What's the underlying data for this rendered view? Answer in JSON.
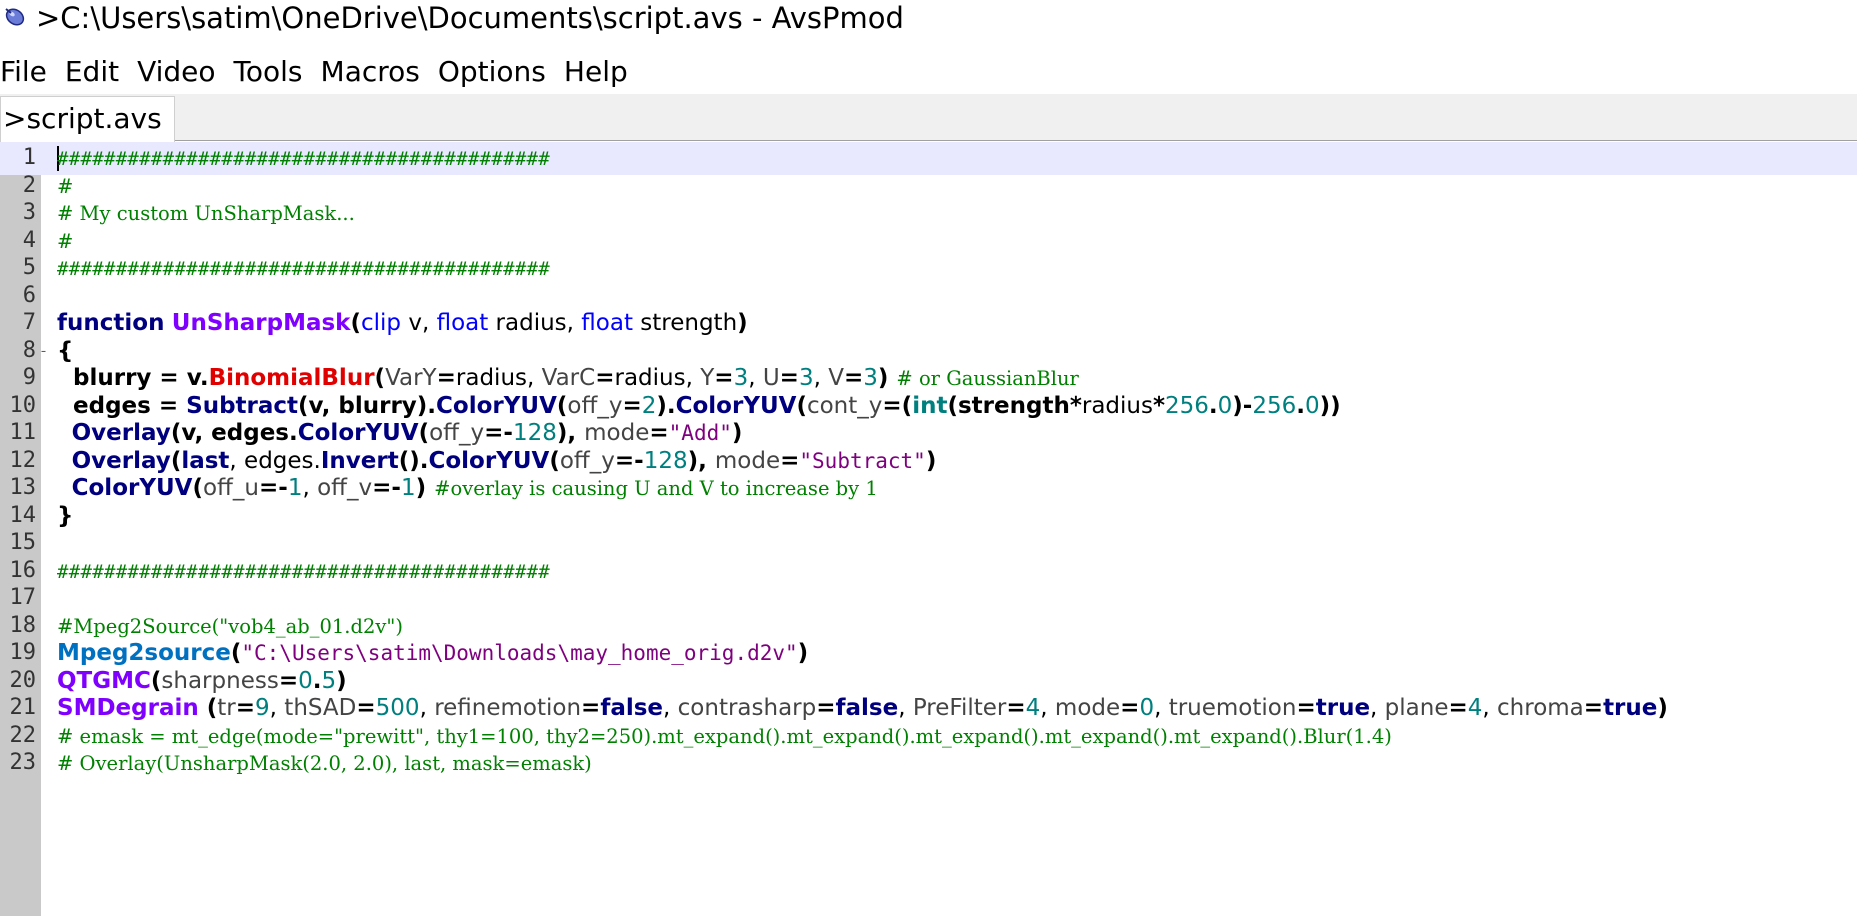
{
  "window": {
    "title": ">C:\\Users\\satim\\OneDrive\\Documents\\script.avs - AvsPmod",
    "icon": "avspmod-app-icon"
  },
  "menu": {
    "items": [
      "File",
      "Edit",
      "Video",
      "Tools",
      "Macros",
      "Options",
      "Help"
    ]
  },
  "tabs": [
    {
      "label": ">script.avs",
      "active": true
    }
  ],
  "editor": {
    "current_line": 1,
    "lines": [
      {
        "n": "1"
      },
      {
        "n": "2"
      },
      {
        "n": "3"
      },
      {
        "n": "4"
      },
      {
        "n": "5"
      },
      {
        "n": "6"
      },
      {
        "n": "7"
      },
      {
        "n": "8"
      },
      {
        "n": "9"
      },
      {
        "n": "10"
      },
      {
        "n": "11"
      },
      {
        "n": "12"
      },
      {
        "n": "13"
      },
      {
        "n": "14"
      },
      {
        "n": "15"
      },
      {
        "n": "16"
      },
      {
        "n": "17"
      },
      {
        "n": "18"
      },
      {
        "n": "19"
      },
      {
        "n": "20"
      },
      {
        "n": "21"
      },
      {
        "n": "22"
      },
      {
        "n": "23"
      }
    ],
    "text": {
      "hashline": "##########################################",
      "hash": "#",
      "l3": "# My custom UnSharpMask...",
      "l7_function": "function",
      "l7_name": "UnSharpMask",
      "l7_open": "(",
      "l7_clip": "clip",
      "l7_v": " v, ",
      "l7_float": "float",
      "l7_radius": " radius, ",
      "l7_float2": "float",
      "l7_strength": " strength",
      "l7_close": ")",
      "l8": "{",
      "l9_a": "  blurry = v.",
      "l9_fn": "BinomialBlur",
      "l9_b": "(",
      "l9_p1": "VarY",
      "l9_e1": "=",
      "l9_v1": "radius, ",
      "l9_p2": "VarC",
      "l9_e2": "=",
      "l9_v2": "radius, ",
      "l9_p3": "Y",
      "l9_e3": "=",
      "l9_n3": "3",
      "l9_c3": ", ",
      "l9_p4": "U",
      "l9_e4": "=",
      "l9_n4": "3",
      "l9_c4": ", ",
      "l9_p5": "V",
      "l9_e5": "=",
      "l9_n5": "3",
      "l9_close": ") ",
      "l9_cm": "# or GaussianBlur",
      "l10_a": "  edges = ",
      "l10_fn1": "Subtract",
      "l10_b": "(v, blurry).",
      "l10_fn2": "ColorYUV",
      "l10_c": "(",
      "l10_p1": "off_y",
      "l10_e1": "=",
      "l10_n1": "2",
      "l10_d": ").",
      "l10_fn3": "ColorYUV",
      "l10_e": "(",
      "l10_p2": "cont_y",
      "l10_e2": "=(",
      "l10_int": "int",
      "l10_f": "(strength",
      "l10_g": "*",
      "l10_h": "radius",
      "l10_i": "*",
      "l10_n2": "256",
      "l10_dot1": ".",
      "l10_n3": "0",
      "l10_j": ")-",
      "l10_n4": "256",
      "l10_dot2": ".",
      "l10_n5": "0",
      "l10_k": "))",
      "l11_a": "  ",
      "l11_fn": "Overlay",
      "l11_b": "(v, edges.",
      "l11_fn2": "ColorYUV",
      "l11_c": "(",
      "l11_p1": "off_y",
      "l11_e1": "=-",
      "l11_n1": "128",
      "l11_d": "), ",
      "l11_p2": "mode",
      "l11_e2": "=",
      "l11_s": "\"Add\"",
      "l11_close": ")",
      "l12_a": "  ",
      "l12_fn": "Overlay",
      "l12_b": "(",
      "l12_last": "last",
      "l12_c": ", edges.",
      "l12_fn2": "Invert",
      "l12_d": "().",
      "l12_fn3": "ColorYUV",
      "l12_e": "(",
      "l12_p1": "off_y",
      "l12_e1": "=-",
      "l12_n1": "128",
      "l12_f": "), ",
      "l12_p2": "mode",
      "l12_e2": "=",
      "l12_s": "\"Subtract\"",
      "l12_close": ")",
      "l13_a": "  ",
      "l13_fn": "ColorYUV",
      "l13_b": "(",
      "l13_p1": "off_u",
      "l13_e1": "=-",
      "l13_n1": "1",
      "l13_c": ", ",
      "l13_p2": "off_v",
      "l13_e2": "=-",
      "l13_n2": "1",
      "l13_close": ") ",
      "l13_cm": "#overlay is causing U and V to increase by 1",
      "l14": "}",
      "l18": "#Mpeg2Source(\"vob4_ab_01.d2v\")",
      "l19_fn": "Mpeg2source",
      "l19_a": "(",
      "l19_s": "\"C:\\Users\\satim\\Downloads\\may_home_orig.d2v\"",
      "l19_b": ")",
      "l20_fn": "QTGMC",
      "l20_a": "(",
      "l20_p": "sharpness",
      "l20_e": "=",
      "l20_n1": "0",
      "l20_dot": ".",
      "l20_n2": "5",
      "l20_b": ")",
      "l21_fn": "SMDegrain",
      "l21_a": " (",
      "l21_p1": "tr",
      "l21_e1": "=",
      "l21_n1": "9",
      "l21_c1": ", ",
      "l21_p2": "thSAD",
      "l21_e2": "=",
      "l21_n2": "500",
      "l21_c2": ", ",
      "l21_p3": "refinemotion",
      "l21_e3": "=",
      "l21_b3": "false",
      "l21_c3": ", ",
      "l21_p4": "contrasharp",
      "l21_e4": "=",
      "l21_b4": "false",
      "l21_c4": ", ",
      "l21_p5": "PreFilter",
      "l21_e5": "=",
      "l21_n5": "4",
      "l21_c5": ", ",
      "l21_p6": "mode",
      "l21_e6": "=",
      "l21_n6": "0",
      "l21_c6": ", ",
      "l21_p7": "truemotion",
      "l21_e7": "=",
      "l21_b7": "true",
      "l21_c7": ", ",
      "l21_p8": "plane",
      "l21_e8": "=",
      "l21_n8": "4",
      "l21_c8": ", ",
      "l21_p9": "chroma",
      "l21_e9": "=",
      "l21_b9": "true",
      "l21_close": ")",
      "l22": "# emask = mt_edge(mode=\"prewitt\", thy1=100, thy2=250).mt_expand().mt_expand().mt_expand().mt_expand().mt_expand().Blur(1.4)",
      "l23": "# Overlay(UnsharpMask(2.0, 2.0), last, mask=emask)"
    }
  },
  "colors": {
    "gutter": "#c9c9c9",
    "current_line": "#e8e8ff",
    "comment": "#008000",
    "keyword": "#00007f",
    "function_name": "#7f00ff",
    "type": "#0000ff",
    "number": "#007f7f",
    "string": "#7f007f",
    "filter_red": "#e00000",
    "filter_blue": "#0070c0"
  }
}
